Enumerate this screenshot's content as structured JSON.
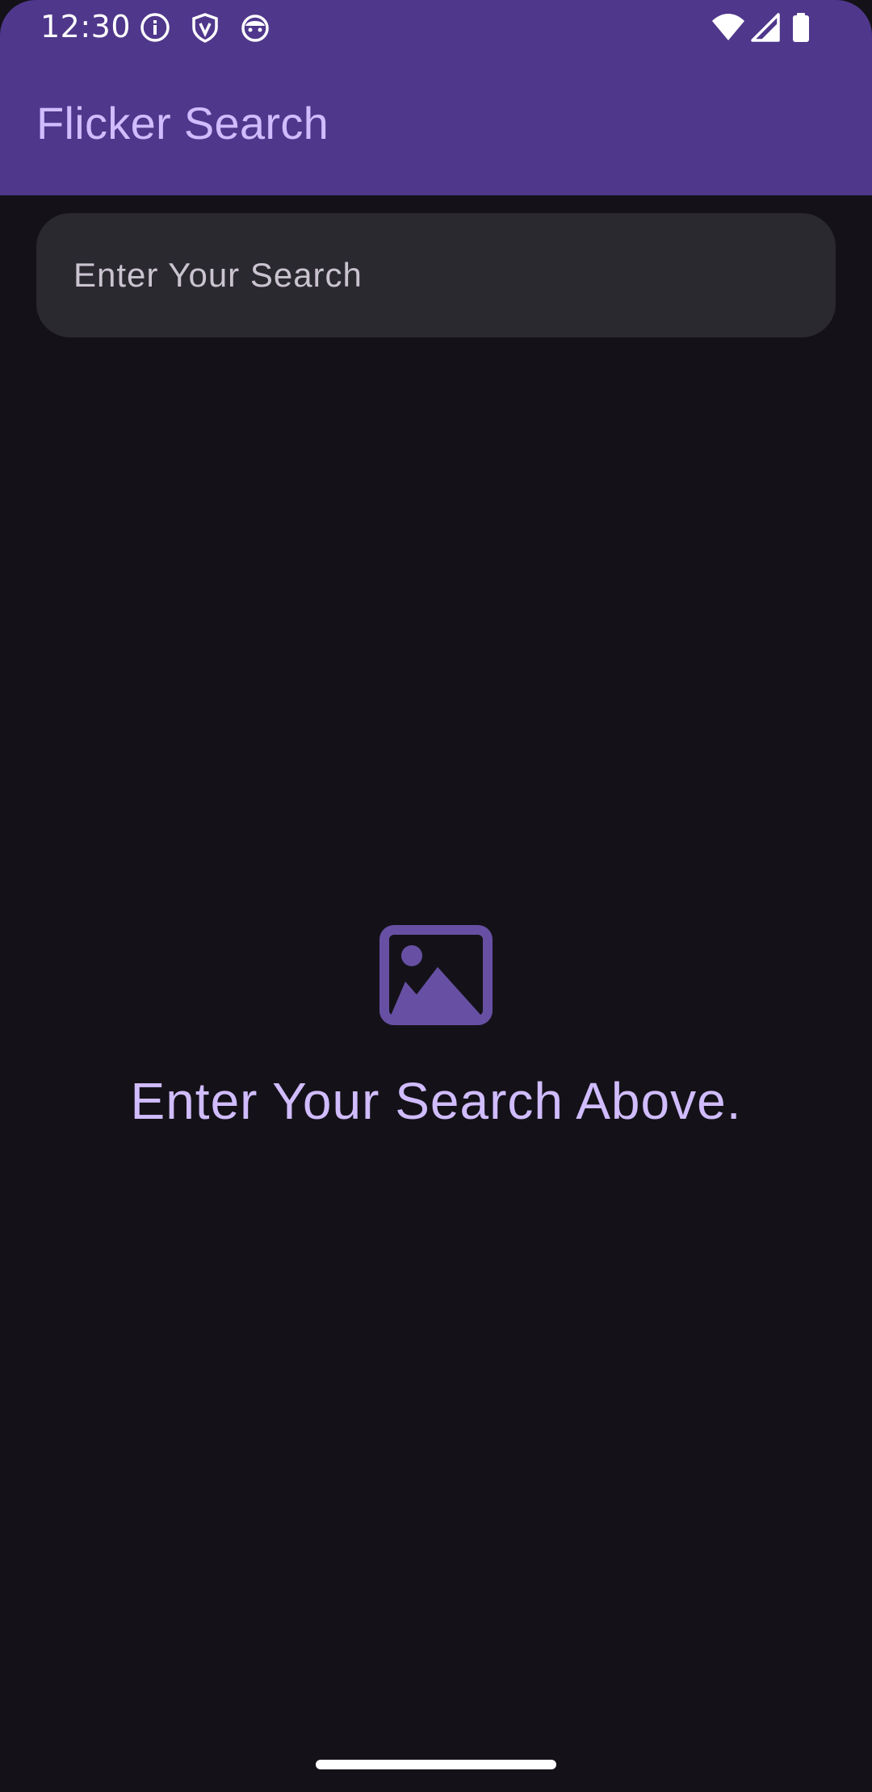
{
  "status_bar": {
    "time": "12:30",
    "left_icons": [
      "info-icon",
      "shield-icon",
      "android-face-icon"
    ],
    "right_icons": [
      "wifi-icon",
      "cell-signal-icon",
      "battery-icon"
    ]
  },
  "app_bar": {
    "title": "Flicker Search",
    "background_color": "#4F378B",
    "title_color": "#D0BCFF"
  },
  "search": {
    "placeholder": "Enter Your Search",
    "value": ""
  },
  "empty_state": {
    "icon": "image-placeholder-icon",
    "icon_color": "#6750A4",
    "message": "Enter Your Search Above."
  },
  "theme": {
    "background": "#141218",
    "surface_variant": "#2B2930"
  }
}
